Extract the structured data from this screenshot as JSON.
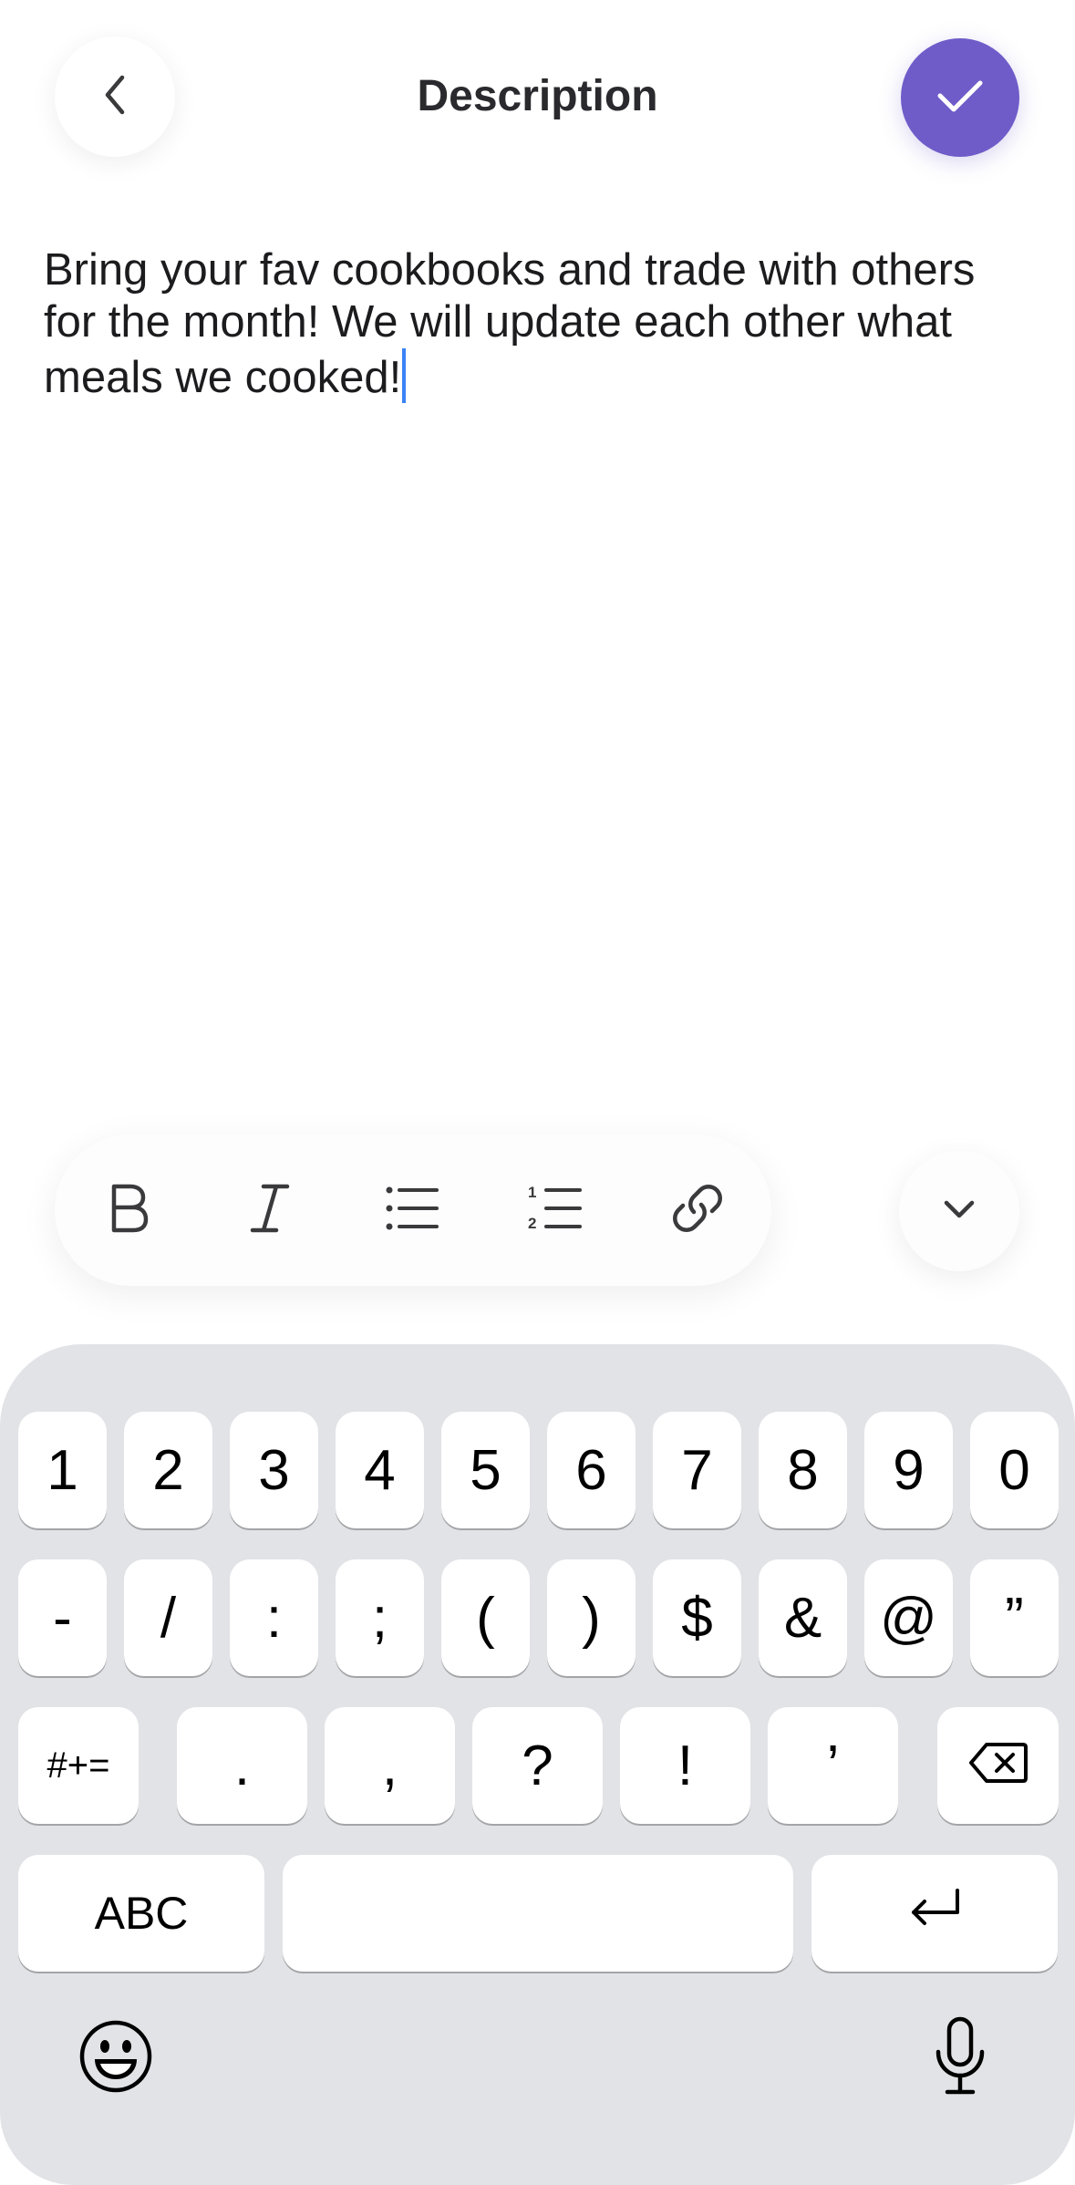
{
  "header": {
    "title": "Description",
    "back_icon": "chevron-left-icon",
    "confirm_icon": "checkmark-icon",
    "accent_color": "#6f5cc9"
  },
  "editor": {
    "text": "Bring your fav cookbooks and trade with others for the month! We will update each other what meals we cooked!"
  },
  "format_toolbar": {
    "items": [
      "bold-icon",
      "italic-icon",
      "bullet-list-icon",
      "numbered-list-icon",
      "link-icon"
    ],
    "collapse_icon": "chevron-down-icon"
  },
  "keyboard": {
    "row1": [
      "1",
      "2",
      "3",
      "4",
      "5",
      "6",
      "7",
      "8",
      "9",
      "0"
    ],
    "row2": [
      "-",
      "/",
      ":",
      ";",
      "(",
      ")",
      "$",
      "&",
      "@",
      "”"
    ],
    "row3": [
      "#+=",
      ".",
      ",",
      "?",
      "!",
      "’"
    ],
    "abc_label": "ABC",
    "delete_icon": "backspace-icon",
    "return_icon": "return-icon",
    "emoji_icon": "emoji-icon",
    "mic_icon": "microphone-icon"
  }
}
